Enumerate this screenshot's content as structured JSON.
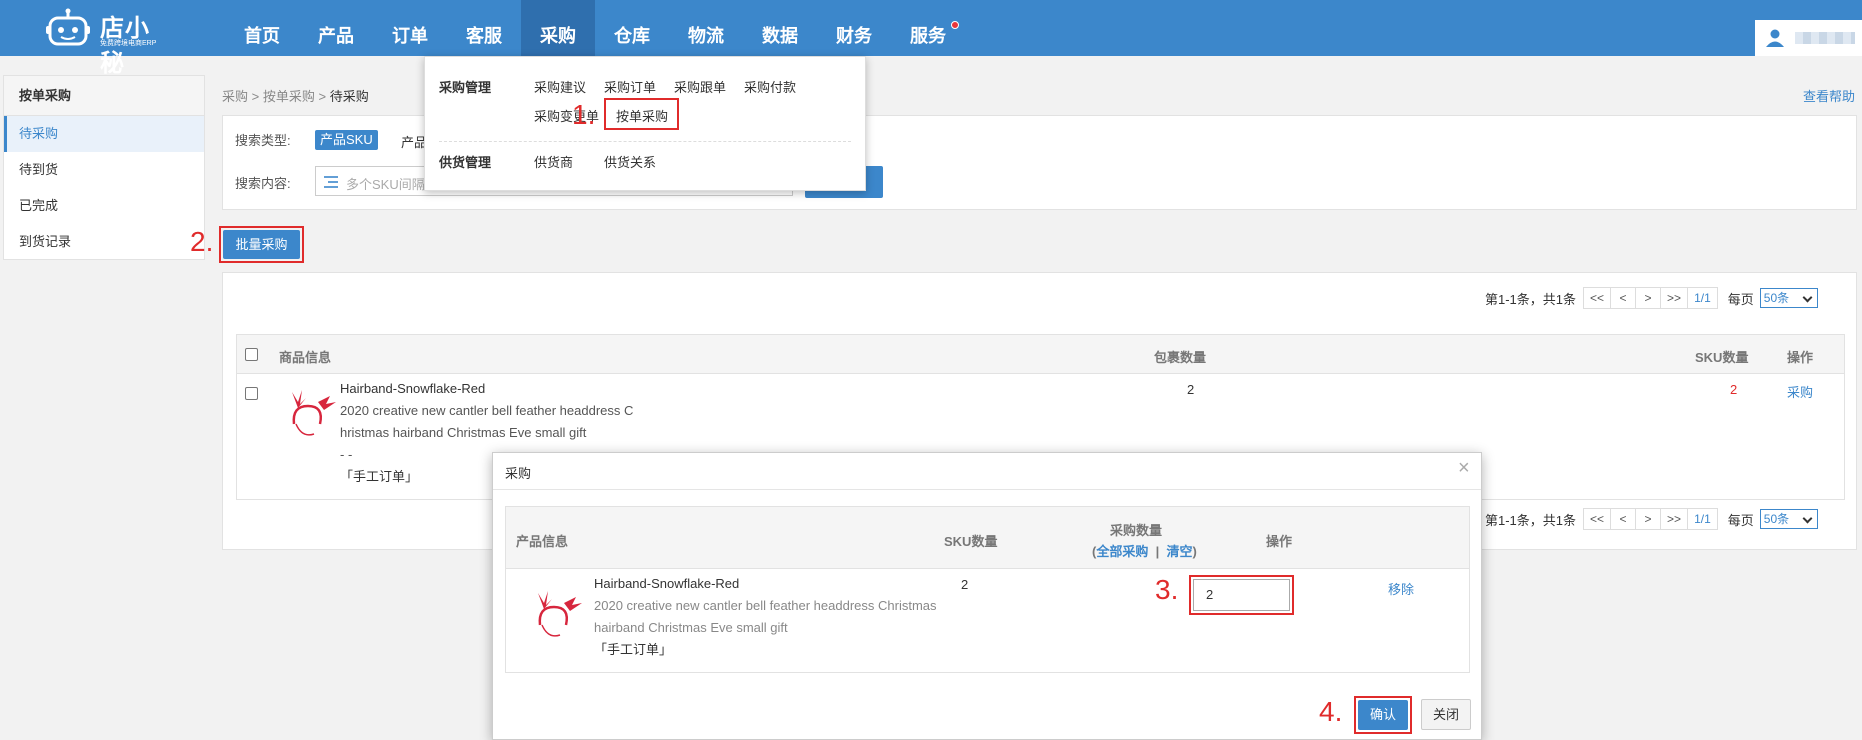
{
  "brand": {
    "name": "店小秘",
    "tagline": "免费跨境电商ERP"
  },
  "nav": {
    "items": [
      "首页",
      "产品",
      "订单",
      "客服",
      "采购",
      "仓库",
      "物流",
      "数据",
      "财务",
      "服务"
    ],
    "active": "采购"
  },
  "sidebar": {
    "title": "按单采购",
    "items": [
      "待采购",
      "待到货",
      "已完成",
      "到货记录"
    ],
    "active": "待采购"
  },
  "breadcrumb": {
    "items": [
      "采购",
      "按单采购",
      "待采购"
    ],
    "sep": ">"
  },
  "help": "查看帮助",
  "search": {
    "type_label": "搜索类型:",
    "type_selected": "产品SKU",
    "type_other": "产品",
    "content_label": "搜索内容:",
    "placeholder": "多个SKU间隔"
  },
  "batch_button": "批量采购",
  "pager": {
    "summary": "第1-1条，共1条",
    "buttons": [
      "<<",
      "<",
      ">",
      ">>"
    ],
    "page": "1/1",
    "per_page_label": "每页",
    "per_page_value": "50条"
  },
  "table": {
    "headers": {
      "product": "商品信息",
      "package_qty": "包裹数量",
      "sku_qty": "SKU数量",
      "action": "操作"
    },
    "row": {
      "title": "Hairband-Snowflake-Red",
      "desc_line1": "2020 creative new cantler bell feather headdress C",
      "desc_line2": "hristmas hairband Christmas Eve small gift",
      "dash": "- -",
      "tag": "「手工订单」",
      "package_qty": "2",
      "sku_qty": "2",
      "action": "采购"
    }
  },
  "dropdown": {
    "group1": "采购管理",
    "group1_items": [
      "采购建议",
      "采购订单",
      "采购跟单",
      "采购付款",
      "采购变更单",
      "按单采购"
    ],
    "group2": "供货管理",
    "group2_items": [
      "供货商",
      "供货关系"
    ]
  },
  "steps": [
    "1.",
    "2.",
    "3.",
    "4."
  ],
  "modal": {
    "title": "采购",
    "close": "×",
    "headers": {
      "product": "产品信息",
      "sku_qty": "SKU数量",
      "purchase_qty": "采购数量",
      "all": "全部采购",
      "clear": "清空",
      "action": "操作"
    },
    "row": {
      "title": "Hairband-Snowflake-Red",
      "desc_line1": "2020 creative new cantler bell feather headdress Christmas",
      "desc_line2": "hairband Christmas Eve small gift",
      "tag": "「手工订单」",
      "sku_qty": "2",
      "qty_value": "2",
      "remove": "移除"
    },
    "confirm": "确认",
    "cancel": "关闭"
  },
  "colors": {
    "primary": "#3c87cb",
    "highlight": "#e02b2b",
    "product_red": "#d7263d"
  }
}
